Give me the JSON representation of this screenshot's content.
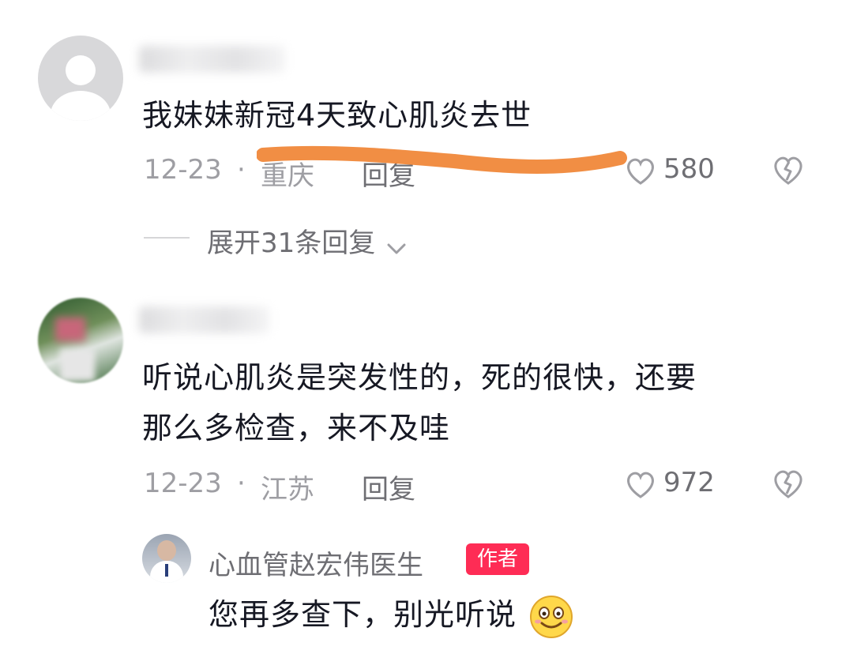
{
  "comments": [
    {
      "text": "我妹妹新冠4天致心肌炎去世",
      "date": "12-23",
      "dot": "·",
      "location": "重庆",
      "reply_label": "回复",
      "likes": "580",
      "expand_label": "展开31条回复"
    },
    {
      "text_line1": "听说心肌炎是突发性的，死的很快，还要",
      "text_line2": "那么多检查，来不及哇",
      "date": "12-23",
      "dot": "·",
      "location": "江苏",
      "reply_label": "回复",
      "likes": "972"
    }
  ],
  "reply": {
    "username": "心血管赵宏伟医生",
    "badge": "作者",
    "text": "您再多查下，别光听说"
  },
  "colors": {
    "highlight_stroke": "#f0883a",
    "badge_bg": "#fe2c55"
  },
  "icons": [
    "heart-icon",
    "broken-heart-icon",
    "chevron-down-icon",
    "smile-emoji"
  ]
}
